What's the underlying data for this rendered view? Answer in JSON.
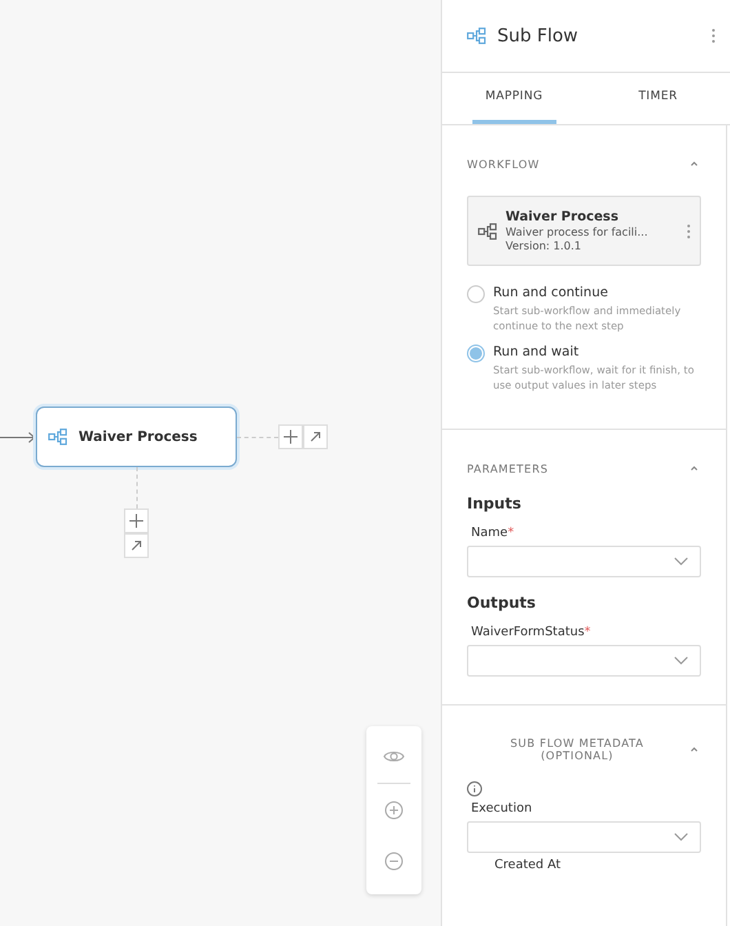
{
  "canvas": {
    "node": {
      "title": "Waiver Process",
      "selected": true
    }
  },
  "panel": {
    "title": "Sub Flow",
    "tabs": [
      {
        "label": "MAPPING",
        "selected": true
      },
      {
        "label": "TIMER",
        "selected": false
      }
    ],
    "workflow": {
      "heading": "WORKFLOW",
      "expanded": true,
      "card": {
        "name": "Waiver Process",
        "description": "Waiver process for facili...",
        "version": "Version: 1.0.1"
      },
      "options": [
        {
          "label": "Run and continue",
          "hint": "Start sub-workflow and immediately continue to the next step",
          "selected": false
        },
        {
          "label": "Run and wait",
          "hint": "Start sub-workflow, wait for it finish, to use output values in later steps",
          "selected": true
        }
      ]
    },
    "parameters": {
      "heading": "PARAMETERS",
      "expanded": true,
      "groups": [
        {
          "title": "Inputs",
          "fields": [
            {
              "label": "Name",
              "required_mark": "*"
            }
          ]
        },
        {
          "title": "Outputs",
          "fields": [
            {
              "label": "WaiverFormStatus",
              "required_mark": "*"
            }
          ]
        }
      ]
    },
    "metadata": {
      "heading": "SUB FLOW METADATA (OPTIONAL)",
      "expanded": true,
      "fields": [
        {
          "label": "Execution",
          "kind": "select"
        },
        {
          "label": "Created At",
          "kind": "label"
        }
      ]
    }
  }
}
